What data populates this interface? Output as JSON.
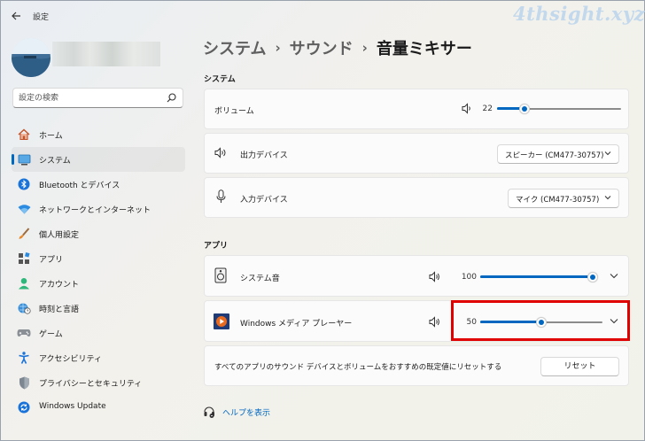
{
  "window": {
    "title": "設定",
    "watermark": "4thsight.xyz"
  },
  "search": {
    "placeholder": "設定の検索"
  },
  "nav": {
    "items": [
      {
        "label": "ホーム",
        "icon": "home-icon"
      },
      {
        "label": "システム",
        "icon": "monitor-icon",
        "active": true
      },
      {
        "label": "Bluetooth とデバイス",
        "icon": "bluetooth-icon"
      },
      {
        "label": "ネットワークとインターネット",
        "icon": "wifi-icon"
      },
      {
        "label": "個人用設定",
        "icon": "brush-icon"
      },
      {
        "label": "アプリ",
        "icon": "apps-icon"
      },
      {
        "label": "アカウント",
        "icon": "account-icon"
      },
      {
        "label": "時刻と言語",
        "icon": "globe-clock-icon"
      },
      {
        "label": "ゲーム",
        "icon": "gamepad-icon"
      },
      {
        "label": "アクセシビリティ",
        "icon": "accessibility-icon"
      },
      {
        "label": "プライバシーとセキュリティ",
        "icon": "shield-icon"
      },
      {
        "label": "Windows Update",
        "icon": "update-icon"
      }
    ]
  },
  "breadcrumb": {
    "part1": "システム",
    "part2": "サウンド",
    "current": "音量ミキサー",
    "separator": "›"
  },
  "system_section": {
    "heading": "システム",
    "volume": {
      "label": "ボリューム",
      "value": "22",
      "level": 22
    },
    "output": {
      "label": "出力デバイス",
      "selected": "スピーカー (CM477-30757)"
    },
    "input": {
      "label": "入力デバイス",
      "selected": "マイク (CM477-30757)"
    }
  },
  "apps_section": {
    "heading": "アプリ",
    "apps": [
      {
        "name": "システム音",
        "value": "100",
        "level": 100
      },
      {
        "name": "Windows メディア プレーヤー",
        "value": "50",
        "level": 50
      }
    ],
    "reset": {
      "text": "すべてのアプリのサウンド デバイスとボリュームをおすすめの既定値にリセットする",
      "button": "リセット"
    }
  },
  "help": {
    "label": "ヘルプを表示"
  },
  "colors": {
    "accent": "#0067c0",
    "highlight": "#e00000"
  }
}
